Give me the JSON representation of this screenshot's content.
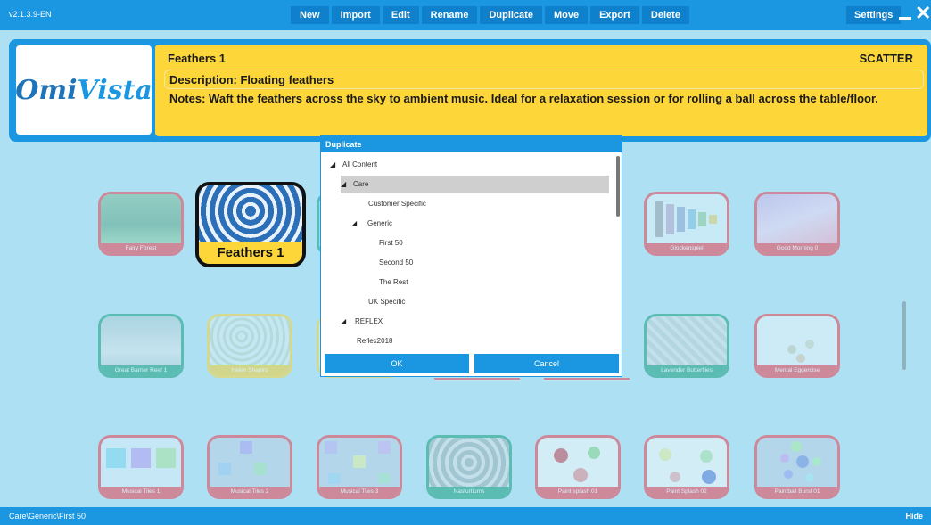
{
  "version": "v2.1.3.9-EN",
  "menu": [
    "New",
    "Import",
    "Edit",
    "Rename",
    "Duplicate",
    "Move",
    "Export",
    "Delete"
  ],
  "settings_label": "Settings",
  "logo_text": "OmiVista",
  "panel": {
    "title": "Feathers 1",
    "type": "SCATTER",
    "description": "Description: Floating feathers",
    "notes": "Notes: Waft the feathers across the sky to ambient music. Ideal for a relaxation session or for rolling a ball across the table/floor."
  },
  "tiles": {
    "fairy_forest": "Fairy Forest",
    "feathers_1": "Feathers 1",
    "glockenspiel": "Glockenspiel",
    "good_morning": "Good Morning 0",
    "great_barrier_reef": "Great Barrier Reef 1",
    "helen_shapiro": "Helen Shapiro",
    "lavender_butterflies": "Lavender Butterflies",
    "mental_eggercise": "Mental Eggercise",
    "musical_tiles_1": "Musical Tiles 1",
    "musical_tiles_2": "Musical Tiles 2",
    "musical_tiles_3": "Musical Tiles 3",
    "nasturtiums": "Nasturtiums",
    "paint_splash_01": "Paint splash 01",
    "paint_splash_02": "Paint Splash 02",
    "paintball_burst": "Paintball Burst 01"
  },
  "dialog": {
    "title": "Duplicate",
    "tree": {
      "all_content": "All Content",
      "care": "Care",
      "customer_specific": "Customer Specific",
      "generic": "Generic",
      "first_50": "First 50",
      "second_50": "Second 50",
      "the_rest": "The Rest",
      "uk_specific": "UK Specific",
      "reflex": "REFLEX",
      "reflex2018": "Reflex2018"
    },
    "expand_glyph": "◢",
    "ok": "OK",
    "cancel": "Cancel"
  },
  "footer": {
    "path": "Care\\Generic\\First 50",
    "hide": "Hide"
  },
  "colors": {
    "accent_blue": "#1a97e0",
    "panel_yellow": "#fdd63a",
    "background": "#aee0f4",
    "tile_red": "#e8424f",
    "tile_teal": "#17a07e"
  }
}
